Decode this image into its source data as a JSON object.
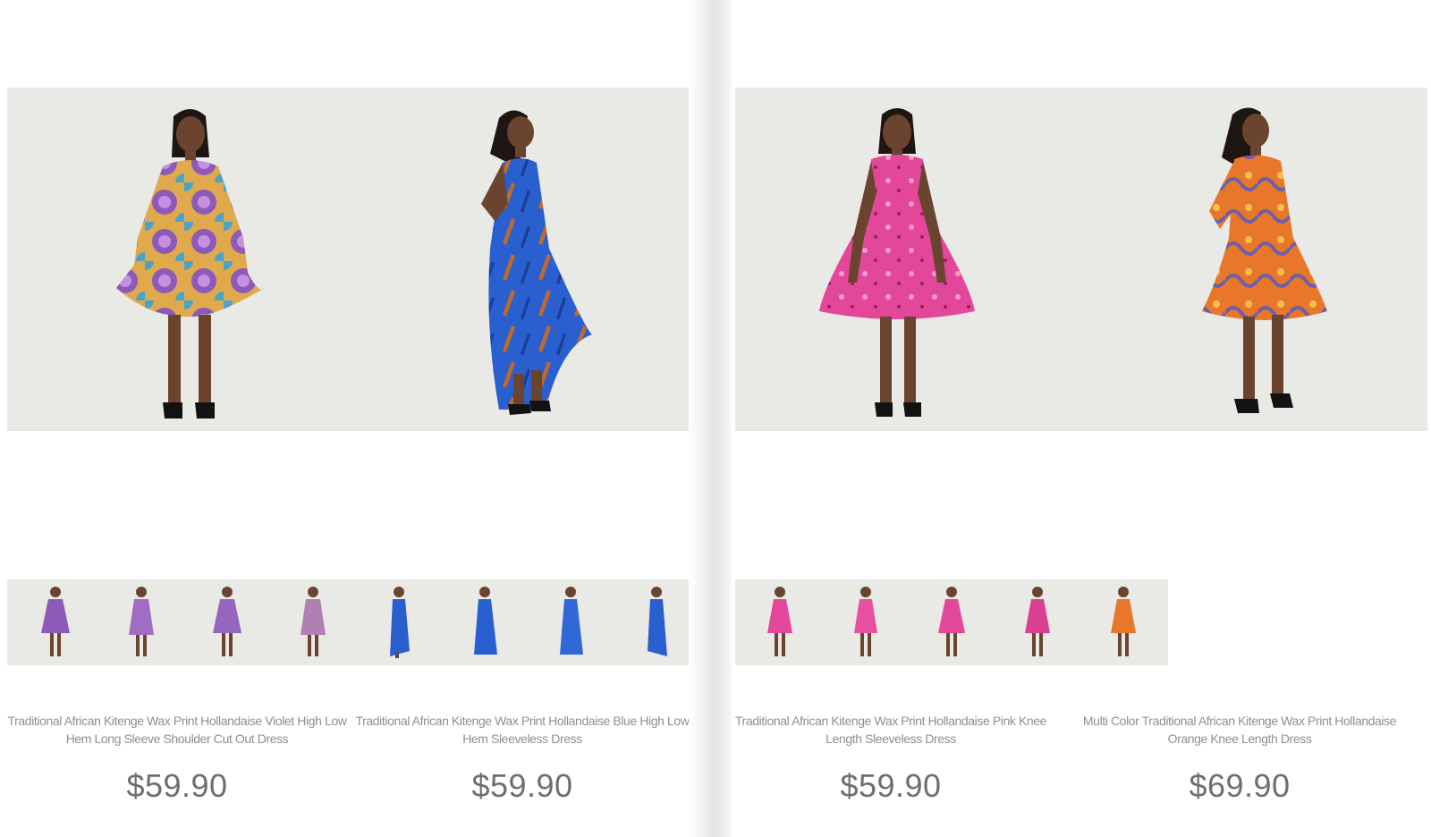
{
  "products": [
    {
      "title": "Traditional African Kitenge Wax Print Hollandaise Violet High Low Hem Long Sleeve Shoulder Cut Out Dress",
      "price": "$59.90"
    },
    {
      "title": "Traditional African Kitenge Wax Print Hollandaise Blue High Low Hem Sleeveless Dress",
      "price": "$59.90"
    },
    {
      "title": "Traditional African Kitenge Wax Print Hollandaise Pink Knee Length Sleeveless Dress",
      "price": "$59.90"
    },
    {
      "title": "Multi Color Traditional African Kitenge Wax Print Hollandaise Orange Knee Length Dress",
      "price": "$69.90"
    }
  ],
  "colors": {
    "violet_dress": "#8e5ab8",
    "blue_dress": "#2a5fd0",
    "pink_dress": "#e2479a",
    "orange_dress": "#e8772a",
    "backdrop": "#e9e9e6",
    "skin": "#6b4430"
  }
}
